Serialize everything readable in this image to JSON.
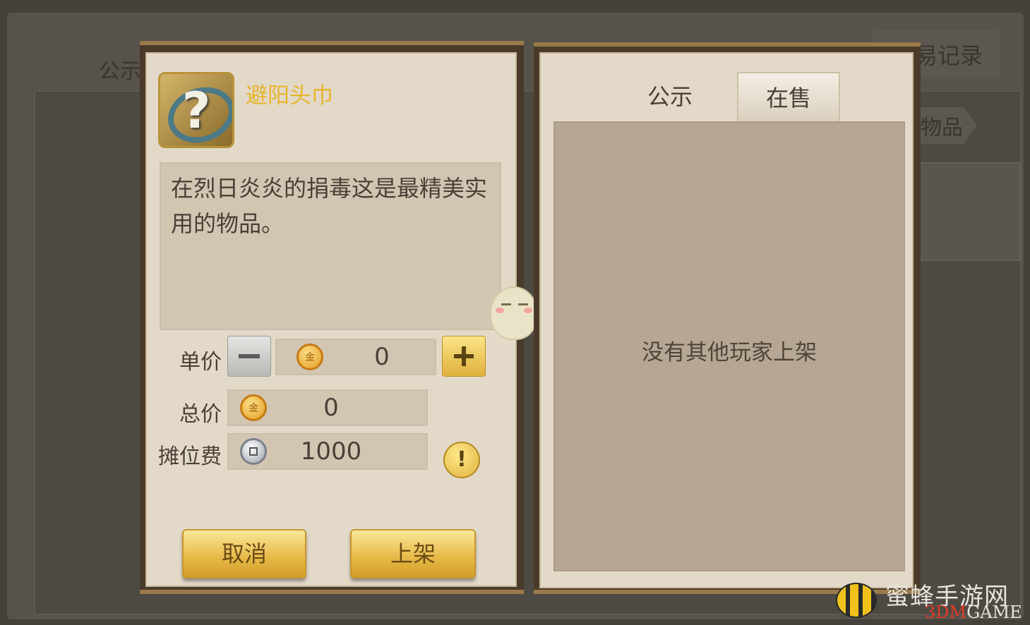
{
  "background": {
    "left_tab_partial": "公示",
    "right_tab_partial": "易记录",
    "tag_partial": "物品"
  },
  "item": {
    "icon": "question-mark-headscarf-icon",
    "name": "避阳头巾",
    "description": "在烈日炎炎的捐毒这是最精美实用的物品。"
  },
  "pricing": {
    "unit_price_label": "单价",
    "unit_price_value": "0",
    "total_price_label": "总价",
    "total_price_value": "0",
    "stall_fee_label": "摊位费",
    "stall_fee_value": "1000",
    "info_symbol": "!"
  },
  "buttons": {
    "cancel": "取消",
    "list": "上架"
  },
  "right_panel": {
    "tabs": [
      {
        "label": "公示",
        "active": false
      },
      {
        "label": "在售",
        "active": true
      }
    ],
    "empty_message": "没有其他玩家上架"
  },
  "watermark": {
    "cn": "蜜蜂手游网",
    "en_prefix": "3DM",
    "en_suffix": "GAME"
  },
  "colors": {
    "item_name": "#e6b52a",
    "gold_button": "#e6b845",
    "panel_bg": "#e3d9c9",
    "list_bg": "#b5a794"
  }
}
